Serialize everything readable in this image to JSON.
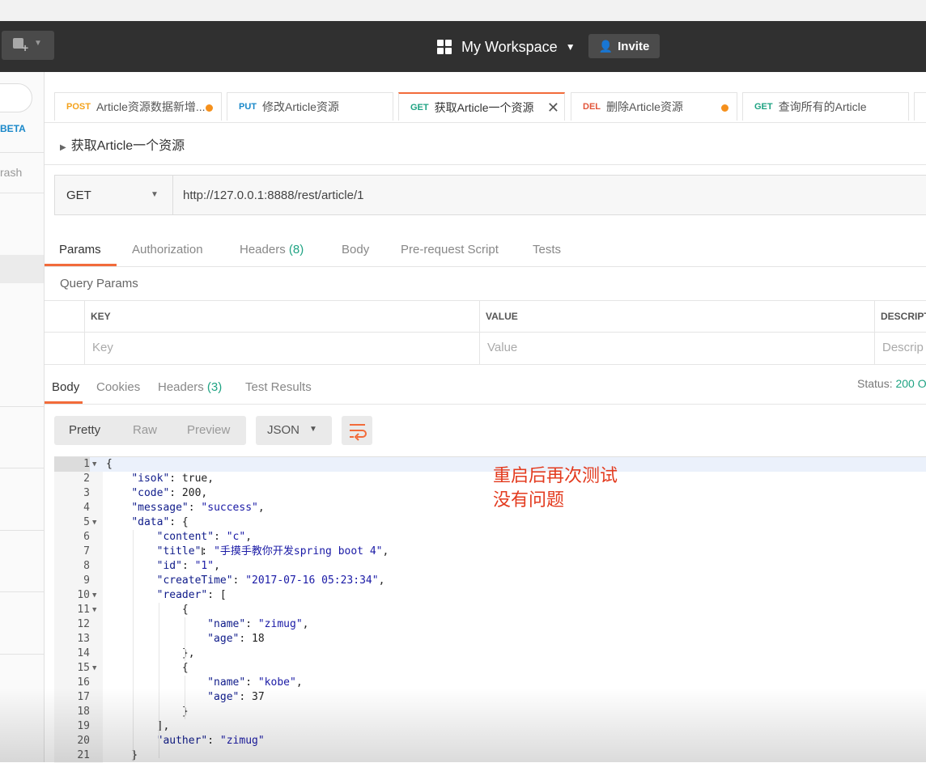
{
  "header": {
    "workspace_label": "My Workspace",
    "invite_label": "Invite"
  },
  "sidebar": {
    "beta_label": "BETA",
    "trash_label": "rash"
  },
  "tabs": [
    {
      "method": "POST",
      "label": "Article资源数据新增..."
    },
    {
      "method": "PUT",
      "label": "修改Article资源"
    },
    {
      "method": "GET",
      "label": "获取Article一个资源"
    },
    {
      "method": "DEL",
      "label": "删除Article资源"
    },
    {
      "method": "GET",
      "label": "查询所有的Article"
    }
  ],
  "request": {
    "title": "获取Article一个资源",
    "method": "GET",
    "url": "http://127.0.0.1:8888/rest/article/1"
  },
  "request_tabs": {
    "params": "Params",
    "authorization": "Authorization",
    "headers": "Headers",
    "headers_count": "(8)",
    "body": "Body",
    "prerequest": "Pre-request Script",
    "tests": "Tests"
  },
  "query_params": {
    "title": "Query Params",
    "col_key": "KEY",
    "col_value": "VALUE",
    "col_desc": "DESCRIPT",
    "ph_key": "Key",
    "ph_value": "Value",
    "ph_desc": "Descrip"
  },
  "response_tabs": {
    "body": "Body",
    "cookies": "Cookies",
    "headers": "Headers",
    "headers_count": "(3)",
    "test_results": "Test Results",
    "status_label": "Status:",
    "status_value": "200 O"
  },
  "view": {
    "pretty": "Pretty",
    "raw": "Raw",
    "preview": "Preview",
    "format": "JSON"
  },
  "code_lines": [
    "{",
    "    \"isok\": true,",
    "    \"code\": 200,",
    "    \"message\": \"success\",",
    "    \"data\": {",
    "        \"content\": \"c\",",
    "        \"title\": \"手摸手教你开发spring boot 4\",",
    "        \"id\": \"1\",",
    "        \"createTime\": \"2017-07-16 05:23:34\",",
    "        \"reader\": [",
    "            {",
    "                \"name\": \"zimug\",",
    "                \"age\": 18",
    "            },",
    "            {",
    "                \"name\": \"kobe\",",
    "                \"age\": 37",
    "            }",
    "        ],",
    "        \"auther\": \"zimug\"",
    "    }"
  ],
  "annotation": {
    "line1": "重启后再次测试",
    "line2": "没有问题"
  },
  "colors": {
    "accent": "#f26b3a",
    "get": "#1fa383",
    "post": "#f4a21c",
    "put": "#1a88c9",
    "del": "#e2553a",
    "annotation": "#e33b1f"
  }
}
